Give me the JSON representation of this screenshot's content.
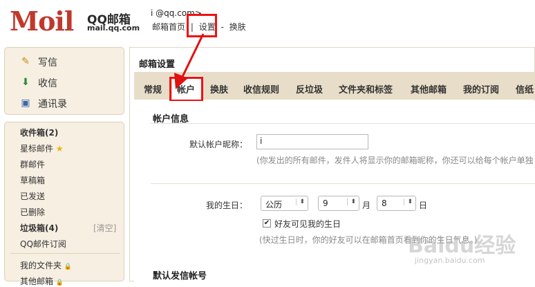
{
  "header": {
    "logo_text": "Moil",
    "brand": "QQ邮箱",
    "domain": "mail.qq.com",
    "user_email": "i                  @qq.com>",
    "links": [
      "邮箱首页",
      "设置",
      "换肤"
    ],
    "link_separators": [
      "|",
      "-"
    ]
  },
  "sidebar": {
    "actions": [
      {
        "label": "写信",
        "icon": "pencil-icon"
      },
      {
        "label": "收信",
        "icon": "inbox-download-icon"
      },
      {
        "label": "通讯录",
        "icon": "contacts-icon"
      }
    ],
    "folders": [
      {
        "label": "收件箱(2)",
        "bold": true
      },
      {
        "label": "星标邮件",
        "icon": "star-icon"
      },
      {
        "label": "群邮件"
      },
      {
        "label": "草稿箱"
      },
      {
        "label": "已发送"
      },
      {
        "label": "已删除"
      },
      {
        "label": "垃圾箱(4)",
        "bold": true,
        "action": "[清空]"
      },
      {
        "label": "QQ邮件订阅"
      },
      {
        "label": "我的文件夹",
        "icon": "lock-icon"
      },
      {
        "label": "其他邮箱",
        "icon": "lock-icon"
      }
    ],
    "star_glyph": "★",
    "lock_glyph": "🔒"
  },
  "main": {
    "title": "邮箱设置",
    "tabs": [
      "常规",
      "帐户",
      "换肤",
      "收信规则",
      "反垃圾",
      "文件夹和标签",
      "其他邮箱",
      "我的订阅",
      "信纸"
    ],
    "active_tab": "帐户",
    "account_section": {
      "title": "帐户信息",
      "nickname_label": "默认帐户昵称：",
      "nickname_value": "i",
      "nickname_hint": "(你发出的所有邮件，发件人将显示你的邮箱昵称，你还可以给每个帐户单独",
      "birthday_label": "我的生日：",
      "calendar_value": "公历",
      "month_value": "9",
      "month_unit": "月",
      "day_value": "8",
      "day_unit": "日",
      "checkbox_label": "好友可见我的生日",
      "checkbox_checked": true,
      "birthday_hint": "(快过生日时，你的好友可以在邮箱首页看到你的生日气息。)"
    },
    "sender_section_title": "默认发信帐号"
  },
  "watermark": {
    "main": "Baidu经验",
    "sub": "jingyan.baidu.com"
  },
  "colors": {
    "logo_red": "#c0392b",
    "highlight_red": "#e11111",
    "tab_bar_bg": "#e8ddc8",
    "sidebar_bg": "#f6efe2"
  }
}
